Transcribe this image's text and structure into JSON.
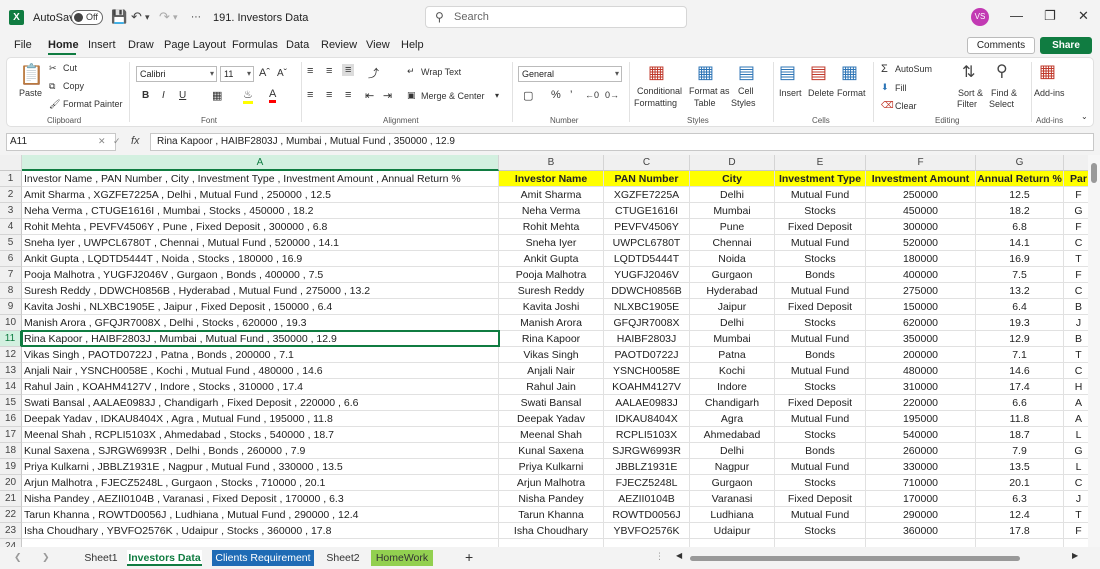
{
  "titlebar": {
    "autosave_label": "AutoSave",
    "autosave_state": "Off",
    "filename": "191. Investors Data",
    "search_placeholder": "Search",
    "user_initials": "VS"
  },
  "menu": [
    "File",
    "Home",
    "Insert",
    "Draw",
    "Page Layout",
    "Formulas",
    "Data",
    "Review",
    "View",
    "Help"
  ],
  "active_menu": "Home",
  "actions": {
    "comments": "Comments",
    "share": "Share"
  },
  "ribbon": {
    "clipboard": {
      "paste": "Paste",
      "cut": "Cut",
      "copy": "Copy",
      "format_painter": "Format Painter",
      "label": "Clipboard"
    },
    "font": {
      "name": "Calibri",
      "size": "11",
      "bold": "B",
      "italic": "I",
      "underline": "U",
      "label": "Font"
    },
    "alignment": {
      "wrap_text": "Wrap Text",
      "merge_center": "Merge & Center",
      "label": "Alignment"
    },
    "number": {
      "format": "General",
      "label": "Number"
    },
    "styles": {
      "conditional": "Conditional",
      "conditional2": "Formatting",
      "format_as": "Format as",
      "format_as2": "Table",
      "cell": "Cell",
      "cell2": "Styles",
      "label": "Styles"
    },
    "cells": {
      "insert": "Insert",
      "delete": "Delete",
      "format": "Format",
      "label": "Cells"
    },
    "editing": {
      "autosum": "AutoSum",
      "fill": "Fill",
      "clear": "Clear",
      "sort": "Sort &",
      "sort2": "Filter",
      "find": "Find &",
      "find2": "Select",
      "label": "Editing"
    },
    "addins": {
      "addins": "Add-ins",
      "label": "Add-ins"
    }
  },
  "namebox": "A11",
  "formula": "Rina Kapoor , HAIBF2803J , Mumbai , Mutual Fund , 350000 , 12.9",
  "columns": [
    "A",
    "B",
    "C",
    "D",
    "E",
    "F",
    "G"
  ],
  "header_row": [
    "Investor Name , PAN Number , City , Investment Type , Investment Amount , Annual Return %",
    "Investor Name",
    "PAN Number",
    "City",
    "Investment Type",
    "Investment Amount",
    "Annual Return %",
    "Par"
  ],
  "rows": [
    [
      "Amit Sharma , XGZFE7225A , Delhi , Mutual Fund , 250000 , 12.5",
      "Amit Sharma",
      "XGZFE7225A",
      "Delhi",
      "Mutual Fund",
      "250000",
      "12.5",
      "F"
    ],
    [
      "Neha Verma , CTUGE1616I , Mumbai , Stocks , 450000 , 18.2",
      "Neha Verma",
      "CTUGE1616I",
      "Mumbai",
      "Stocks",
      "450000",
      "18.2",
      "G"
    ],
    [
      "Rohit Mehta , PEVFV4506Y , Pune , Fixed Deposit , 300000 , 6.8",
      "Rohit Mehta",
      "PEVFV4506Y",
      "Pune",
      "Fixed Deposit",
      "300000",
      "6.8",
      "F"
    ],
    [
      "Sneha Iyer , UWPCL6780T , Chennai , Mutual Fund , 520000 , 14.1",
      "Sneha Iyer",
      "UWPCL6780T",
      "Chennai",
      "Mutual Fund",
      "520000",
      "14.1",
      "C"
    ],
    [
      "Ankit Gupta , LQDTD5444T , Noida , Stocks , 180000 , 16.9",
      "Ankit Gupta",
      "LQDTD5444T",
      "Noida",
      "Stocks",
      "180000",
      "16.9",
      "T"
    ],
    [
      "Pooja Malhotra , YUGFJ2046V , Gurgaon , Bonds , 400000 , 7.5",
      "Pooja Malhotra",
      "YUGFJ2046V",
      "Gurgaon",
      "Bonds",
      "400000",
      "7.5",
      "F"
    ],
    [
      "Suresh Reddy , DDWCH0856B , Hyderabad , Mutual Fund , 275000 , 13.2",
      "Suresh Reddy",
      "DDWCH0856B",
      "Hyderabad",
      "Mutual Fund",
      "275000",
      "13.2",
      "C"
    ],
    [
      "Kavita Joshi , NLXBC1905E , Jaipur , Fixed Deposit , 150000 , 6.4",
      "Kavita Joshi",
      "NLXBC1905E",
      "Jaipur",
      "Fixed Deposit",
      "150000",
      "6.4",
      "B"
    ],
    [
      "Manish Arora , GFQJR7008X , Delhi , Stocks , 620000 , 19.3",
      "Manish Arora",
      "GFQJR7008X",
      "Delhi",
      "Stocks",
      "620000",
      "19.3",
      "J"
    ],
    [
      "Rina Kapoor , HAIBF2803J , Mumbai , Mutual Fund , 350000 , 12.9",
      "Rina Kapoor",
      "HAIBF2803J",
      "Mumbai",
      "Mutual Fund",
      "350000",
      "12.9",
      "B"
    ],
    [
      "Vikas Singh , PAOTD0722J , Patna , Bonds , 200000 , 7.1",
      "Vikas Singh",
      "PAOTD0722J",
      "Patna",
      "Bonds",
      "200000",
      "7.1",
      "T"
    ],
    [
      "Anjali Nair , YSNCH0058E , Kochi , Mutual Fund , 480000 , 14.6",
      "Anjali Nair",
      "YSNCH0058E",
      "Kochi",
      "Mutual Fund",
      "480000",
      "14.6",
      "C"
    ],
    [
      "Rahul Jain , KOAHM4127V , Indore , Stocks , 310000 , 17.4",
      "Rahul Jain",
      "KOAHM4127V",
      "Indore",
      "Stocks",
      "310000",
      "17.4",
      "H"
    ],
    [
      "Swati Bansal , AALAE0983J , Chandigarh , Fixed Deposit , 220000 , 6.6",
      "Swati Bansal",
      "AALAE0983J",
      "Chandigarh",
      "Fixed Deposit",
      "220000",
      "6.6",
      "A"
    ],
    [
      "Deepak Yadav , IDKAU8404X , Agra , Mutual Fund , 195000 , 11.8",
      "Deepak Yadav",
      "IDKAU8404X",
      "Agra",
      "Mutual Fund",
      "195000",
      "11.8",
      "A"
    ],
    [
      "Meenal Shah , RCPLI5103X , Ahmedabad , Stocks , 540000 , 18.7",
      "Meenal Shah",
      "RCPLI5103X",
      "Ahmedabad",
      "Stocks",
      "540000",
      "18.7",
      "L"
    ],
    [
      "Kunal Saxena , SJRGW6993R , Delhi , Bonds , 260000 , 7.9",
      "Kunal Saxena",
      "SJRGW6993R",
      "Delhi",
      "Bonds",
      "260000",
      "7.9",
      "G"
    ],
    [
      "Priya Kulkarni , JBBLZ1931E , Nagpur , Mutual Fund , 330000 , 13.5",
      "Priya Kulkarni",
      "JBBLZ1931E",
      "Nagpur",
      "Mutual Fund",
      "330000",
      "13.5",
      "L"
    ],
    [
      "Arjun Malhotra , FJECZ5248L , Gurgaon , Stocks , 710000 , 20.1",
      "Arjun Malhotra",
      "FJECZ5248L",
      "Gurgaon",
      "Stocks",
      "710000",
      "20.1",
      "C"
    ],
    [
      "Nisha Pandey , AEZII0104B , Varanasi , Fixed Deposit , 170000 , 6.3",
      "Nisha Pandey",
      "AEZII0104B",
      "Varanasi",
      "Fixed Deposit",
      "170000",
      "6.3",
      "J"
    ],
    [
      "Tarun Khanna , ROWTD0056J , Ludhiana , Mutual Fund , 290000 , 12.4",
      "Tarun Khanna",
      "ROWTD0056J",
      "Ludhiana",
      "Mutual Fund",
      "290000",
      "12.4",
      "T"
    ],
    [
      "Isha Choudhary , YBVFO2576K , Udaipur , Stocks , 360000 , 17.8",
      "Isha Choudhary",
      "YBVFO2576K",
      "Udaipur",
      "Stocks",
      "360000",
      "17.8",
      "F"
    ]
  ],
  "sheets": [
    "Sheet1",
    "Investors Data",
    "Clients Requirement",
    "Sheet2",
    "HomeWork"
  ],
  "active_sheet": "Investors Data",
  "colors": {
    "accent": "#107c41",
    "header_fill": "#ffff00",
    "tab_clients": "#1f6bb5",
    "tab_homework": "#92d050"
  }
}
